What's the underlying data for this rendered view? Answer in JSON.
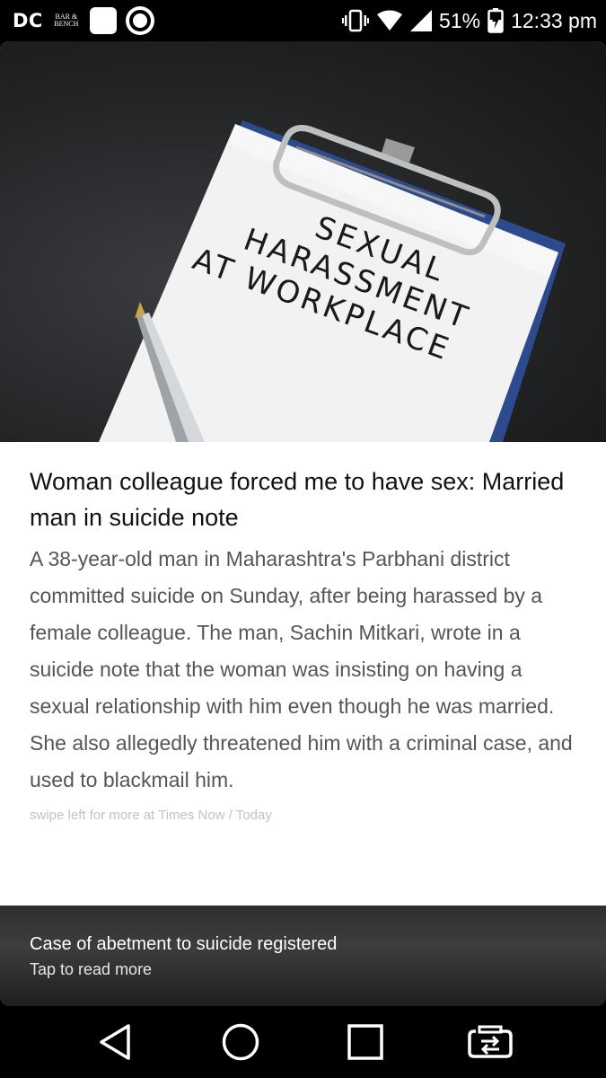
{
  "status_bar": {
    "left_logo": "DC",
    "bar_bench_logo": "BAR & BENCH",
    "battery": "51%",
    "time": "12:33 pm",
    "icons": [
      "vibrate-icon",
      "wifi-icon",
      "signal-icon",
      "battery-charging-icon"
    ]
  },
  "article": {
    "image_text": [
      "SEXUAL",
      "HARASSMENT",
      "AT WORKPLACE"
    ],
    "headline": "Woman colleague forced me to have sex: Married man in suicide note",
    "body": "A 38-year-old man in Maharashtra's Parbhani district committed suicide on Sunday, after being harassed by a female colleague. The man, Sachin Mitkari, wrote in a suicide note that the woman was insisting on having a sexual relationship with him even though he was married. She also allegedly threatened him with a criminal case, and used to blackmail him.",
    "source": "swipe left for more at Times Now / Today"
  },
  "teaser": {
    "title": "Case of abetment to suicide registered",
    "subtitle": "Tap to read more"
  },
  "nav": {
    "icons": [
      "back-icon",
      "home-icon",
      "recents-icon",
      "screen-switch-icon"
    ]
  }
}
